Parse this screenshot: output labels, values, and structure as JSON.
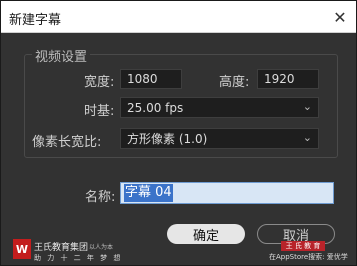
{
  "window": {
    "title": "新建字幕",
    "close_glyph": "✕"
  },
  "video_settings": {
    "legend": "视频设置",
    "width_label": "宽度:",
    "width_value": "1080",
    "height_label": "高度:",
    "height_value": "1920",
    "timebase_label": "时基:",
    "timebase_value": "25.00 fps",
    "pixel_aspect_label": "像素长宽比:",
    "pixel_aspect_value": "方形像素 (1.0)"
  },
  "name": {
    "label": "名称:",
    "value": "字幕 04"
  },
  "buttons": {
    "ok_label": "确定",
    "cancel_label": "取消"
  },
  "watermark": {
    "logo_glyph": "W",
    "brand": "王氏教育集团",
    "tagline": "以人为本",
    "slogan": "助 力 十 二 年 梦 想",
    "source_text": "在AppStore搜索: 爱优学",
    "source_badge": "王 氏 教 育"
  },
  "colors": {
    "accent": "#3b73c9",
    "dialog_bg": "#323232"
  },
  "icons": {
    "close": "close-icon",
    "dropdown": "chevron-down-icon"
  }
}
